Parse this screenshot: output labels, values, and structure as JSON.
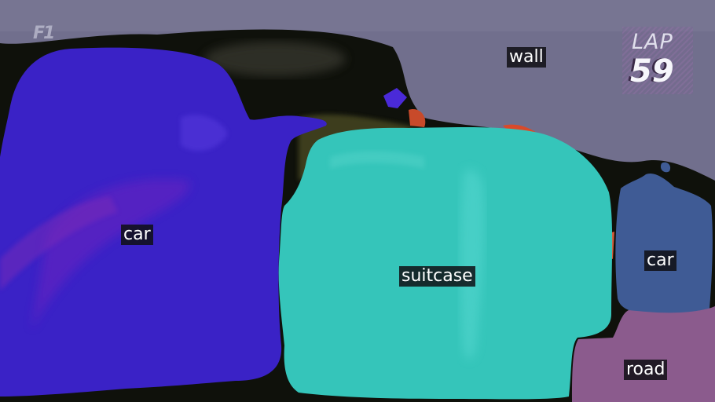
{
  "segments": [
    {
      "label": "car",
      "color": "#3a24c8"
    },
    {
      "label": "suitcase",
      "color": "#33c4b8"
    },
    {
      "label": "wall",
      "color": "#7a7899"
    },
    {
      "label": "car",
      "color": "#3e5a94"
    },
    {
      "label": "road",
      "color": "#8a5a8a"
    }
  ],
  "overlay": {
    "lap_text": "LAP",
    "lap_number": "59",
    "logo_text": "F1"
  }
}
